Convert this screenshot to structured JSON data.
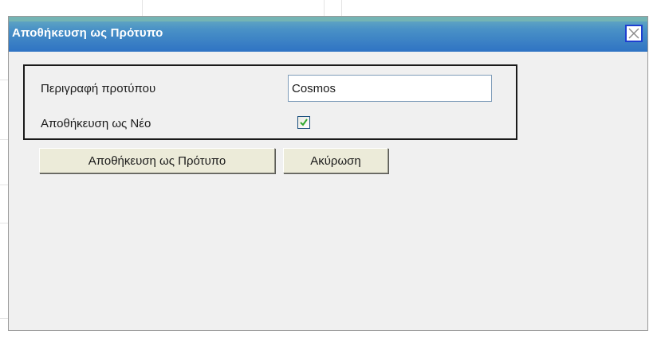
{
  "dialog": {
    "title": "Αποθήκευση ως Πρότυπο"
  },
  "form": {
    "description_label": "Περιγραφή προτύπου",
    "description_value": "Cosmos",
    "save_as_new_label": "Αποθήκευση ως Νέο",
    "save_as_new_checked": true
  },
  "buttons": {
    "save_label": "Αποθήκευση ως Πρότυπο",
    "cancel_label": "Ακύρωση"
  },
  "icons": {
    "close": "close-icon",
    "check": "checkmark-icon"
  },
  "colors": {
    "titlebar": "#2f73c4",
    "close_border": "#1e3fd0",
    "checkmark": "#2fa82f"
  }
}
